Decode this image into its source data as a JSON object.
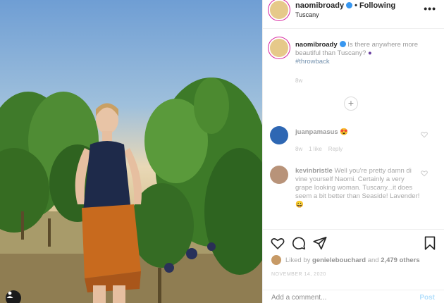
{
  "post": {
    "image_alt": "",
    "author": "naomibroady",
    "follow_state": "Following",
    "location": "Tuscany",
    "caption_text": "Is there anywhere more beautiful than Tuscany?",
    "hashtag": "#throwback",
    "caption_time": "8w"
  },
  "comments": [
    {
      "user": "juanpamasus",
      "text": "😍",
      "meta_time": "8w",
      "meta_likes": "1 like",
      "meta_reply": "Reply"
    },
    {
      "user": "kevinbristle",
      "text": "Well you're pretty damn di vine yourself Naomi. Certainly a very grape looking woman. Tuscany...it does seem a bit better than Seaside! Lavender! 😀"
    }
  ],
  "actions": {
    "liked_prefix": "Liked by",
    "liked_user": "genielebouchard",
    "liked_connector": "and",
    "liked_count": "2,479 others",
    "date": "NOVEMBER 14, 2020"
  },
  "composer": {
    "placeholder": "Add a comment...",
    "post_label": "Post"
  },
  "colors": {
    "accent": "#3897f0",
    "story_ring": "#d6249f",
    "post_disabled": "#b2dffc"
  }
}
